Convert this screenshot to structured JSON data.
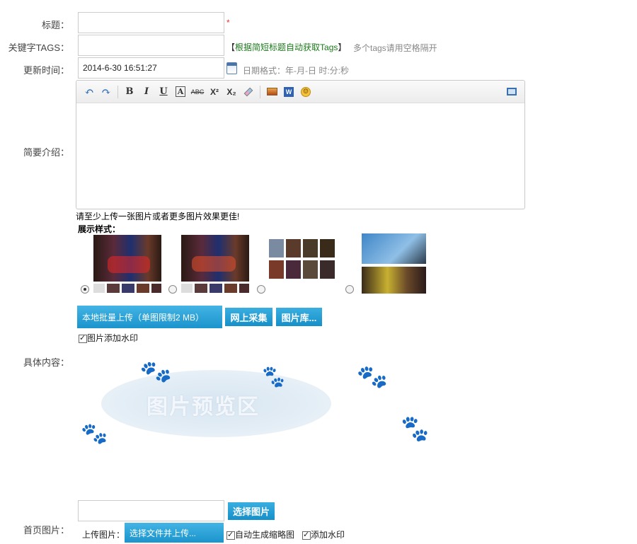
{
  "form": {
    "title_label": "标题：",
    "required_mark": "*",
    "tags_label": "关键字TAGS：",
    "tags_button_open": "【",
    "tags_button_text": "根据简短标题自动获取Tags",
    "tags_button_close": "】",
    "tags_hint": "多个tags请用空格隔开",
    "time_label": "更新时间：",
    "time_value": "2014-6-30 16:51:27",
    "time_hint": "日期格式：年-月-日 时:分:秒",
    "intro_label": "简要介绍：",
    "content_label": "具体内容：",
    "cover_label": "首页图片："
  },
  "editor": {
    "tools": [
      "undo-icon",
      "redo-icon",
      "bold-icon",
      "italic-icon",
      "underline-icon",
      "font-color-icon",
      "strikethrough-icon",
      "superscript-icon",
      "subscript-icon",
      "eraser-icon",
      "image-icon",
      "word-icon",
      "emoticon-icon",
      "fullscreen-icon"
    ],
    "bold": "B",
    "italic": "I",
    "underline": "U",
    "fontcolor": "A",
    "strike": "ABC",
    "sup": "X²",
    "sub": "X₂"
  },
  "upload": {
    "tip": "请至少上传一张图片或者更多图片效果更佳!",
    "style_label": "展示样式：",
    "local_batch_button": "本地批量上传（单图限制2 MB）",
    "web_collect_button": "网上采集",
    "gallery_button": "图片库...",
    "watermark_label": "图片添加水印",
    "watermark_checked": true,
    "preview_text": "图片预览区",
    "selected_style": 0
  },
  "cover": {
    "choose_button": "选择图片",
    "upload_label": "上传图片：",
    "upload_button": "选择文件并上传...",
    "auto_thumb_label": "自动生成缩略图",
    "auto_thumb_checked": true,
    "add_watermark_label": "添加水印",
    "add_watermark_checked": true
  },
  "colors": {
    "accent": "#1a9ad6",
    "required": "#e33333",
    "tag_link": "#1a7a1a"
  }
}
